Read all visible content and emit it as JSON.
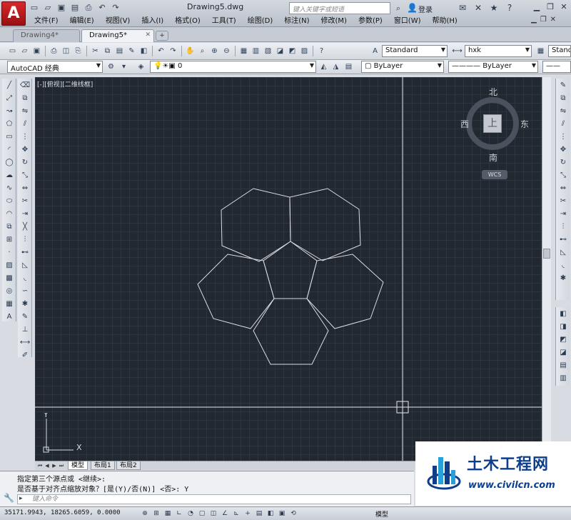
{
  "titlebar": {
    "app_logo": "A",
    "doc_title": "Drawing5.dwg",
    "search_placeholder": "键入关键字或短语",
    "login_label": "登录",
    "qa_icons": [
      "new-icon",
      "open-icon",
      "save-icon",
      "saveas-icon",
      "print-icon",
      "undo-icon",
      "redo-icon"
    ],
    "win_controls": [
      "minimize-icon",
      "restore-icon",
      "close-icon"
    ]
  },
  "menubar": {
    "items": [
      "文件(F)",
      "编辑(E)",
      "视图(V)",
      "插入(I)",
      "格式(O)",
      "工具(T)",
      "绘图(D)",
      "标注(N)",
      "修改(M)",
      "参数(P)",
      "窗口(W)",
      "帮助(H)"
    ]
  },
  "tabs": {
    "items": [
      {
        "label": "Drawing4*",
        "active": false
      },
      {
        "label": "Drawing5*",
        "active": true
      }
    ]
  },
  "toolbar_standard": {
    "text_style": "Standard",
    "dim_style": "hxk",
    "table_style": "Standard"
  },
  "toolbar_layers": {
    "workspace": "AutoCAD 经典",
    "layer": "0",
    "color": "ByLayer",
    "linetype": "ByLayer"
  },
  "canvas": {
    "viewport_label": "[-][俯视][二维线框]",
    "background_color": "#212830",
    "line_color": "#d8dce2"
  },
  "viewcube": {
    "north": "北",
    "south": "南",
    "east": "东",
    "west": "西",
    "face": "上",
    "wcs": "WCS"
  },
  "ucs": {
    "x": "X",
    "y": "Y"
  },
  "layout_tabs": {
    "items": [
      "模型",
      "布局1",
      "布局2"
    ]
  },
  "command": {
    "line1": "指定第三个源点或 <继续>:",
    "line2": "是否基于对齐点缩放对象？[是(Y)/否(N)] <否>: Y",
    "input_placeholder": "键入命令"
  },
  "status": {
    "coords": "35171.9943, 18265.6059, 0.0000",
    "model": "模型"
  },
  "watermark": {
    "title": "土木工程网",
    "url": "www.civilcn.com"
  }
}
